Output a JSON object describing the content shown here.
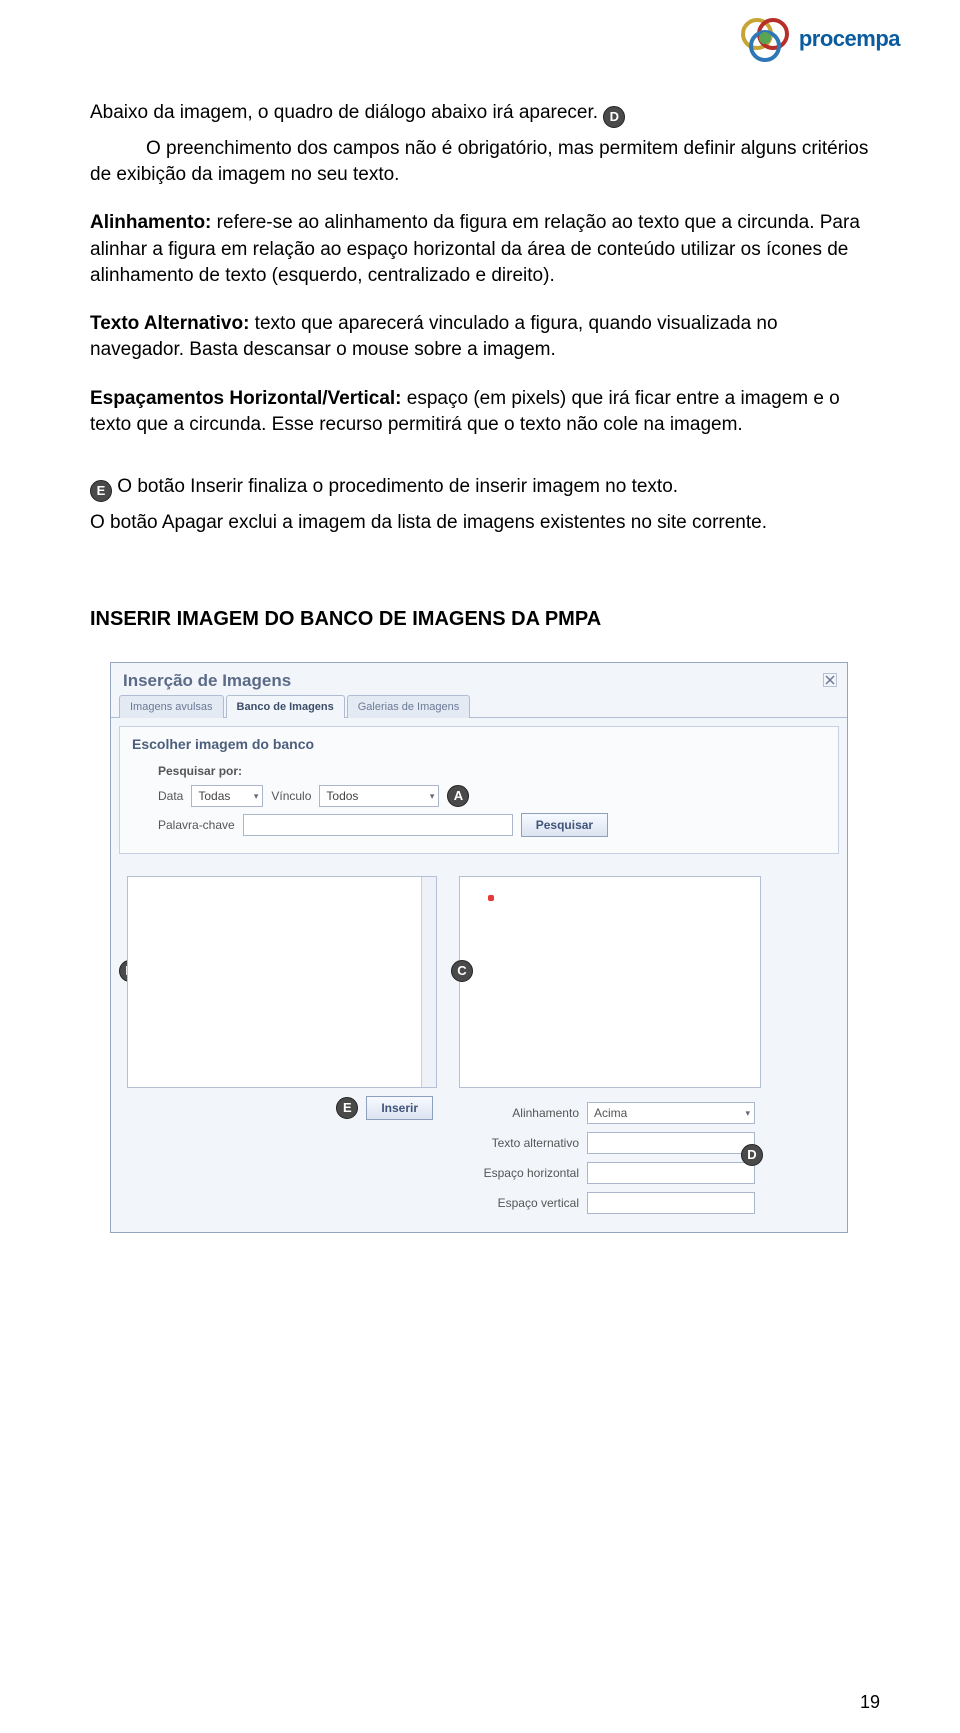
{
  "logo": {
    "text": "procempa"
  },
  "markers": {
    "a": "A",
    "b": "B",
    "c": "C",
    "d": "D",
    "e": "E"
  },
  "para": {
    "p1": "Abaixo da imagem, o quadro de diálogo abaixo irá aparecer.",
    "p2": "O preenchimento dos campos não é obrigatório, mas permitem definir alguns critérios de exibição da imagem no seu texto.",
    "p3a": "Alinhamento:",
    "p3b": " refere-se ao alinhamento da figura em relação ao texto que a circunda. Para alinhar a figura em relação ao espaço horizontal da área de conteúdo utilizar os ícones de alinhamento de texto (esquerdo, centralizado e direito).",
    "p4a": "Texto Alternativo:",
    "p4b": " texto que aparecerá vinculado a figura, quando visualizada no navegador. Basta descansar o mouse sobre a imagem.",
    "p5a": "Espaçamentos Horizontal/Vertical:",
    "p5b": " espaço (em pixels) que irá ficar entre a imagem e o texto que a circunda. Esse recurso permitirá que o texto não cole na imagem.",
    "p6": " O botão Inserir finaliza o procedimento de inserir imagem no texto.",
    "p7": "O botão Apagar exclui a imagem da lista de imagens existentes no site corrente."
  },
  "section_title": "INSERIR IMAGEM DO BANCO DE IMAGENS DA PMPA",
  "dialog": {
    "title": "Inserção de Imagens",
    "tabs": [
      "Imagens avulsas",
      "Banco de Imagens",
      "Galerias de Imagens"
    ],
    "panel_title": "Escolher imagem do banco",
    "search_label": "Pesquisar por:",
    "data_label": "Data",
    "data_value": "Todas",
    "vinculo_label": "Vínculo",
    "vinculo_value": "Todos",
    "palavra_label": "Palavra-chave",
    "pesquisar_btn": "Pesquisar",
    "inserir_btn": "Inserir",
    "props": {
      "alinhamento_label": "Alinhamento",
      "alinhamento_value": "Acima",
      "texto_alt_label": "Texto alternativo",
      "esp_h_label": "Espaço horizontal",
      "esp_v_label": "Espaço vertical"
    }
  },
  "page_number": "19"
}
